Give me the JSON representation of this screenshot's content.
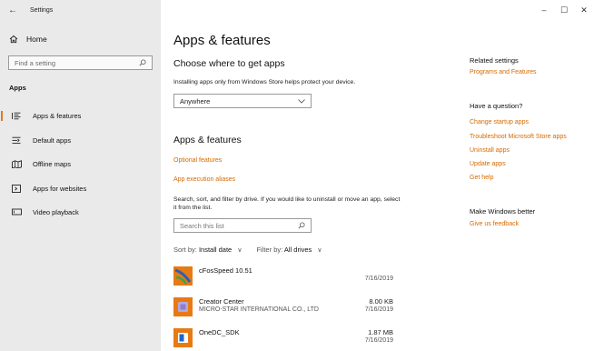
{
  "window": {
    "title": "Settings",
    "minimize": "–",
    "maximize": "☐",
    "close": "✕"
  },
  "sidebar": {
    "home": "Home",
    "search_placeholder": "Find a setting",
    "section": "Apps",
    "items": [
      {
        "label": "Apps & features",
        "icon": "list-icon",
        "active": true
      },
      {
        "label": "Default apps",
        "icon": "default-apps-icon",
        "active": false
      },
      {
        "label": "Offline maps",
        "icon": "map-icon",
        "active": false
      },
      {
        "label": "Apps for websites",
        "icon": "website-icon",
        "active": false
      },
      {
        "label": "Video playback",
        "icon": "video-icon",
        "active": false
      }
    ]
  },
  "main": {
    "title": "Apps & features",
    "choose_title": "Choose where to get apps",
    "install_desc": "Installing apps only from Windows Store helps protect your device.",
    "source_value": "Anywhere",
    "section_title": "Apps & features",
    "optional_features": "Optional features",
    "execution_aliases": "App execution aliases",
    "filter_desc": "Search, sort, and filter by drive. If you would like to uninstall or move an app, select it from the list.",
    "search_placeholder": "Search this list",
    "sort_label": "Sort by:",
    "sort_value": "Install date",
    "filter_label": "Filter by:",
    "filter_value": "All drives",
    "apps": [
      {
        "name": "cFosSpeed 10.51",
        "publisher": "",
        "size": "",
        "date": "7/16/2019"
      },
      {
        "name": "Creator Center",
        "publisher": "MICRO-STAR INTERNATIONAL CO., LTD",
        "size": "8.00 KB",
        "date": "7/16/2019"
      },
      {
        "name": "OneDC_SDK",
        "publisher": "",
        "size": "1.87 MB",
        "date": "7/16/2019"
      }
    ]
  },
  "rail": {
    "related_title": "Related settings",
    "programs_link": "Programs and Features",
    "question_title": "Have a question?",
    "question_links": [
      "Change startup apps",
      "Troubleshoot Microsoft Store apps",
      "Uninstall apps",
      "Update apps",
      "Get help"
    ],
    "better_title": "Make Windows better",
    "feedback_link": "Give us feedback"
  },
  "colors": {
    "accent": "#d56a00",
    "sidebar_bg": "#eaeaea",
    "active_bar": "#e07b20"
  }
}
